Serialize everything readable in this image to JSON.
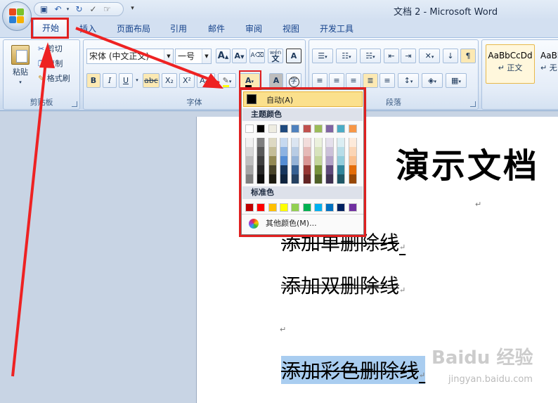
{
  "window": {
    "title": "文档 2 - Microsoft Word"
  },
  "tabs": [
    {
      "key": "home",
      "label": "开始"
    },
    {
      "key": "insert",
      "label": "插入"
    },
    {
      "key": "layout",
      "label": "页面布局"
    },
    {
      "key": "references",
      "label": "引用"
    },
    {
      "key": "mailings",
      "label": "邮件"
    },
    {
      "key": "review",
      "label": "审阅"
    },
    {
      "key": "view",
      "label": "视图"
    },
    {
      "key": "developer",
      "label": "开发工具"
    }
  ],
  "clipboard": {
    "label": "剪贴板",
    "paste": "粘贴",
    "cut": "剪切",
    "copy": "复制",
    "format_painter": "格式刷"
  },
  "font_group": {
    "label": "字体",
    "font_name": "宋体 (中文正文)",
    "font_size": "一号",
    "wen_label": "wén",
    "wen_char": "文",
    "bold": "B",
    "italic": "I",
    "underline": "U",
    "strike": "abc",
    "subscript": "X₂",
    "superscript": "X²",
    "aa": "Aa",
    "font_color_letter": "A",
    "char_shading_letter": "A",
    "enclose_char": "字"
  },
  "paragraph": {
    "label": "段落"
  },
  "styles": {
    "normal_preview": "AaBbCcDd",
    "normal_name": "↵ 正文",
    "nospacing_preview": "AaBl",
    "nospacing_name": "↵ 无"
  },
  "color_menu": {
    "automatic": "自动(A)",
    "theme_colors_label": "主题颜色",
    "standard_colors_label": "标准色",
    "more_colors": "其他颜色(M)...",
    "theme_top": [
      "#FFFFFF",
      "#000000",
      "#EEECE1",
      "#1F497D",
      "#4F81BD",
      "#C0504D",
      "#9BBB59",
      "#8064A2",
      "#4BACC6",
      "#F79646"
    ],
    "theme_shades": [
      [
        "#F2F2F2",
        "#D8D8D8",
        "#BFBFBF",
        "#A5A5A5",
        "#7F7F7F"
      ],
      [
        "#7F7F7F",
        "#595959",
        "#3F3F3F",
        "#262626",
        "#0C0C0C"
      ],
      [
        "#DDD9C3",
        "#C4BD97",
        "#938953",
        "#494429",
        "#1D1B10"
      ],
      [
        "#C6D9F0",
        "#8DB3E2",
        "#548DD4",
        "#17365D",
        "#0F243E"
      ],
      [
        "#DBE5F1",
        "#B8CCE4",
        "#95B3D7",
        "#366092",
        "#244061"
      ],
      [
        "#F2DCDB",
        "#E5B9B7",
        "#D99694",
        "#953734",
        "#632423"
      ],
      [
        "#EBF1DD",
        "#D7E3BC",
        "#C3D69B",
        "#76923C",
        "#4F6128"
      ],
      [
        "#E5E0EC",
        "#CCC1D9",
        "#B2A2C7",
        "#5F497A",
        "#3F3151"
      ],
      [
        "#DBEEF3",
        "#B7DDE8",
        "#92CDDC",
        "#31859B",
        "#205867"
      ],
      [
        "#FDEADA",
        "#FBD5B5",
        "#FAC08F",
        "#E36C09",
        "#974806"
      ]
    ],
    "standard": [
      "#C00000",
      "#FF0000",
      "#FFC000",
      "#FFFF00",
      "#92D050",
      "#00B050",
      "#00B0F0",
      "#0070C0",
      "#002060",
      "#7030A0"
    ]
  },
  "document": {
    "title": "演示文档",
    "line_single": "添加单删除线",
    "line_double": "添加双删除线",
    "line_color": "添加彩色删除线",
    "para_mark": "↵"
  },
  "watermark": {
    "brand": "Baidu 经验",
    "url": "jingyan.baidu.com"
  },
  "colors": {
    "highlight_box": "#E02020",
    "ribbon_bg": "#DEE8F5",
    "selection": "#A9CDF0"
  }
}
